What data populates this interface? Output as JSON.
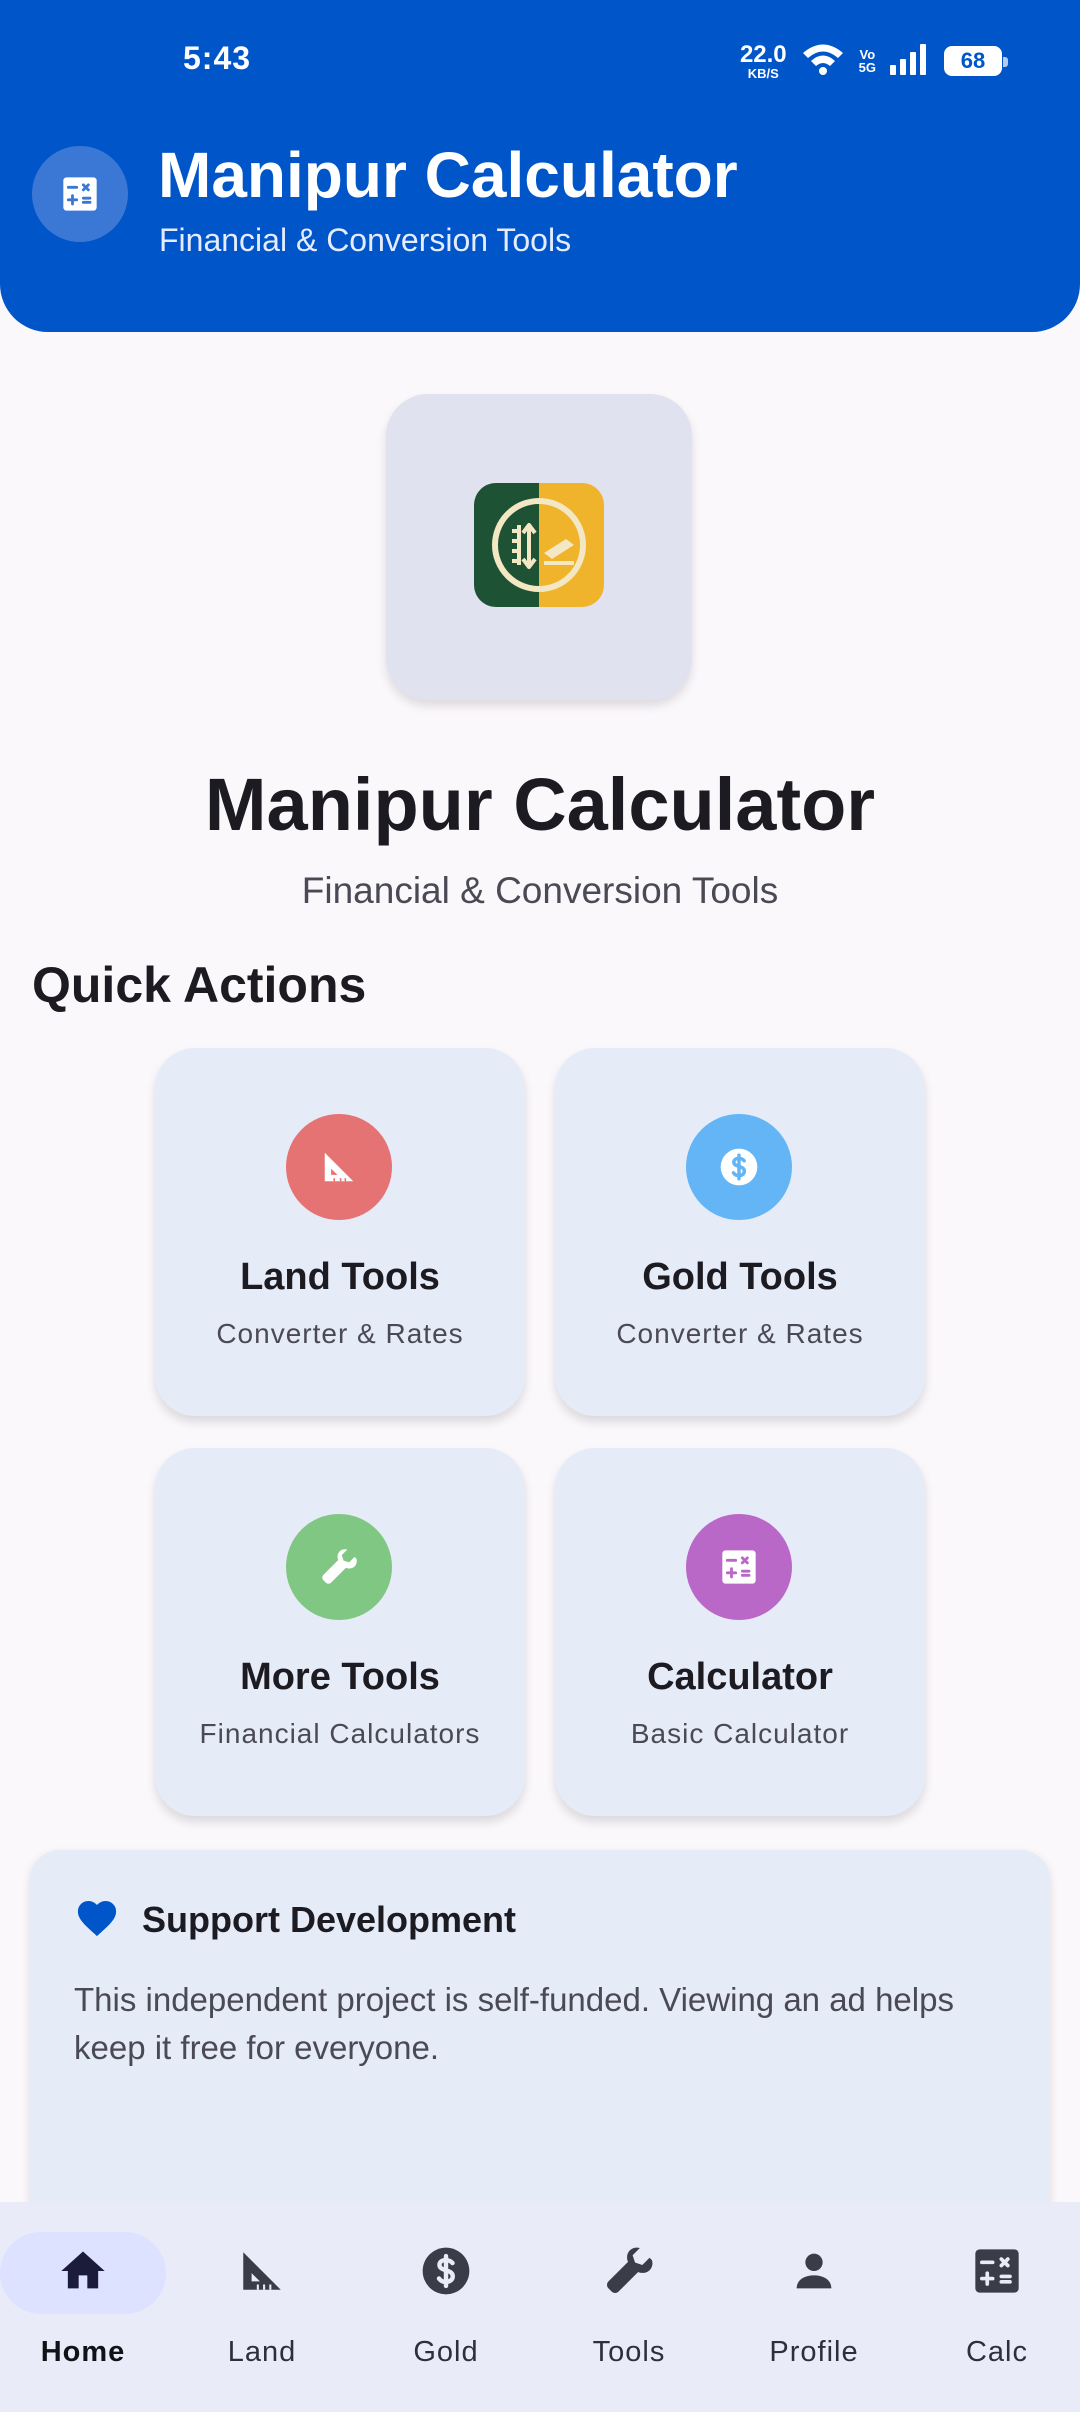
{
  "status_bar": {
    "time": "5:43",
    "net_speed_value": "22.0",
    "net_speed_unit": "KB/S",
    "volte_top": "Vo",
    "volte_bottom": "5G",
    "battery": "68"
  },
  "header": {
    "title": "Manipur Calculator",
    "subtitle": "Financial & Conversion Tools",
    "badge_icon": "calculator-icon"
  },
  "hero": {
    "logo_icon": "app-logo-icon",
    "title": "Manipur Calculator",
    "subtitle": "Financial & Conversion Tools"
  },
  "quick_actions": {
    "title": "Quick Actions",
    "items": [
      {
        "label": "Land Tools",
        "subtitle": "Converter & Rates",
        "icon": "set-square-icon",
        "color": "#e57373"
      },
      {
        "label": "Gold Tools",
        "subtitle": "Converter & Rates",
        "icon": "dollar-circle-icon",
        "color": "#64b5f6"
      },
      {
        "label": "More Tools",
        "subtitle": "Financial Calculators",
        "icon": "wrench-icon",
        "color": "#81c784"
      },
      {
        "label": "Calculator",
        "subtitle": "Basic Calculator",
        "icon": "calculator-icon",
        "color": "#ba68c8"
      }
    ]
  },
  "support": {
    "title": "Support Development",
    "body": "This independent project is self-funded. Viewing an ad helps keep it free for everyone.",
    "icon": "heart-icon",
    "accent": "#0056c9"
  },
  "bottom_nav": {
    "items": [
      {
        "label": "Home",
        "icon": "home-icon",
        "active": true
      },
      {
        "label": "Land",
        "icon": "set-square-icon",
        "active": false
      },
      {
        "label": "Gold",
        "icon": "dollar-circle-icon",
        "active": false
      },
      {
        "label": "Tools",
        "icon": "wrench-icon",
        "active": false
      },
      {
        "label": "Profile",
        "icon": "person-icon",
        "active": false
      },
      {
        "label": "Calc",
        "icon": "calculator-icon",
        "active": false
      }
    ]
  },
  "colors": {
    "primary": "#0056c9",
    "card_background": "#e6ebf8",
    "page_background": "#fbf8fc"
  }
}
